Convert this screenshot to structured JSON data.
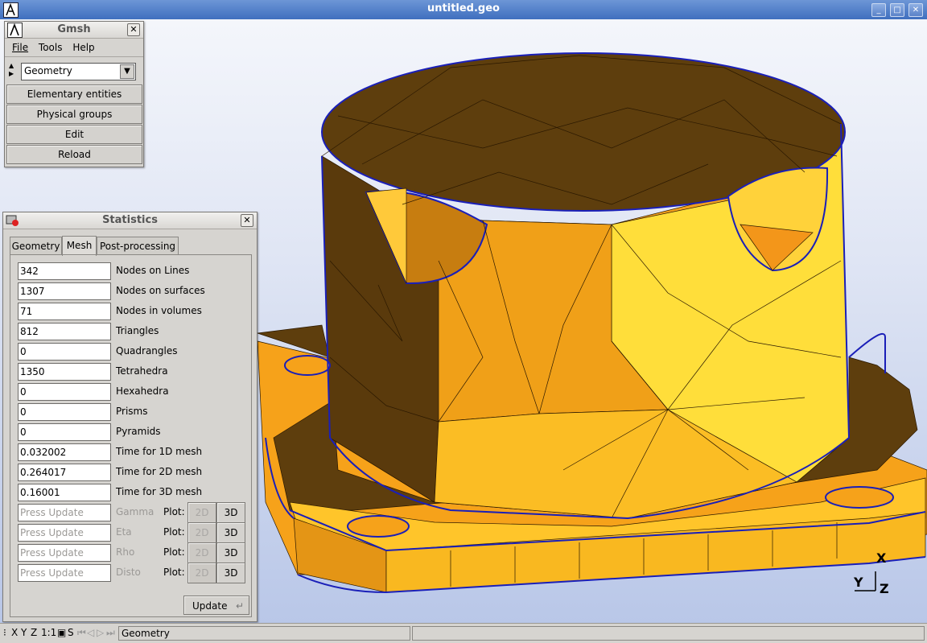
{
  "window": {
    "title": "untitled.geo"
  },
  "gmsh_panel": {
    "title": "Gmsh",
    "menu": [
      "File",
      "Tools",
      "Help"
    ],
    "module_value": "Geometry",
    "buttons": [
      "Elementary entities",
      "Physical groups",
      "Edit",
      "Reload"
    ]
  },
  "statistics": {
    "title": "Statistics",
    "tabs": [
      "Geometry",
      "Mesh",
      "Post-processing"
    ],
    "active_tab": "Mesh",
    "rows": [
      {
        "value": "342",
        "label": "Nodes on Lines"
      },
      {
        "value": "1307",
        "label": "Nodes on surfaces"
      },
      {
        "value": "71",
        "label": "Nodes in volumes"
      },
      {
        "value": "812",
        "label": "Triangles"
      },
      {
        "value": "0",
        "label": "Quadrangles"
      },
      {
        "value": "1350",
        "label": "Tetrahedra"
      },
      {
        "value": "0",
        "label": "Hexahedra"
      },
      {
        "value": "0",
        "label": "Prisms"
      },
      {
        "value": "0",
        "label": "Pyramids"
      },
      {
        "value": "0.032002",
        "label": "Time for 1D mesh"
      },
      {
        "value": "0.264017",
        "label": "Time for 2D mesh"
      },
      {
        "value": "0.16001",
        "label": "Time for 3D mesh"
      }
    ],
    "quality_rows": [
      {
        "placeholder": "Press Update",
        "label": "Gamma",
        "plot": "Plot:",
        "b2d": "2D",
        "b3d": "3D"
      },
      {
        "placeholder": "Press Update",
        "label": "Eta",
        "plot": "Plot:",
        "b2d": "2D",
        "b3d": "3D"
      },
      {
        "placeholder": "Press Update",
        "label": "Rho",
        "plot": "Plot:",
        "b2d": "2D",
        "b3d": "3D"
      },
      {
        "placeholder": "Press Update",
        "label": "Disto",
        "plot": "Plot:",
        "b2d": "2D",
        "b3d": "3D"
      }
    ],
    "update_label": "Update"
  },
  "axes": {
    "x": "X",
    "y": "Y",
    "z": "Z"
  },
  "statusbar": {
    "buttons": [
      "X",
      "Y",
      "Z",
      "1:1",
      "S"
    ],
    "message": "Geometry"
  },
  "colors": {
    "mesh_dark": "#5a3a0c",
    "mesh_orange": "#f6a21a",
    "mesh_yellow": "#ffd93a",
    "outline": "#1a1fb8"
  }
}
